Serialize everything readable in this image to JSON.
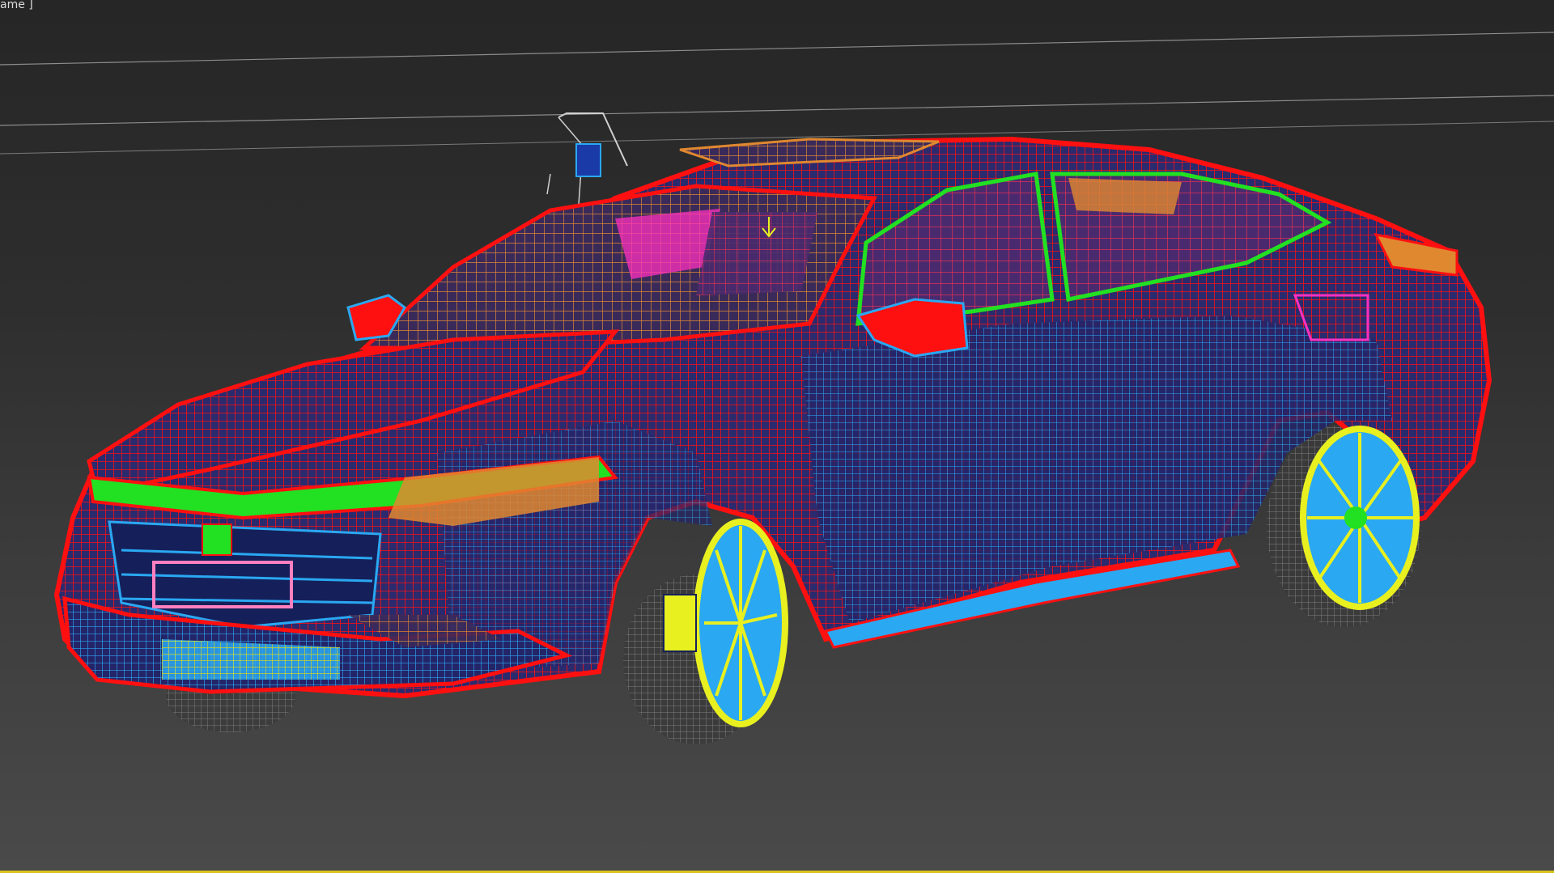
{
  "viewport": {
    "label": "ame ]",
    "shading_mode": "wireframe",
    "background_top": "#262626",
    "background_bottom": "#4a4a4a",
    "frame_border_color": "#d8c21a"
  },
  "model": {
    "object_type": "car",
    "display": "wireframe",
    "colors": {
      "body": "#ff1010",
      "inner_mesh": "#2aa8f2",
      "glass_fill": "#4a2a6e",
      "roof_mesh": "#e08830",
      "interior": "#ff30c0",
      "trim": "#22e022",
      "wheels": "#e8f020",
      "grille": "#15205a",
      "tires": "#8a8a8a"
    }
  },
  "icons": [
    "camera-icon",
    "target-icon"
  ]
}
